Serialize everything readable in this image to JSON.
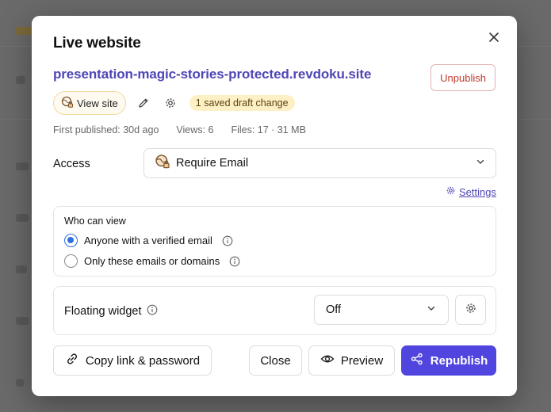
{
  "dialog": {
    "title": "Live website",
    "site_url": "presentation-magic-stories-protected.revdoku.site",
    "unpublish_label": "Unpublish",
    "view_site_label": "View site",
    "draft_badge": "1 saved draft change",
    "meta": {
      "first_published": "First published: 30d ago",
      "views": "Views: 6",
      "files": "Files: 17 · 31 MB"
    },
    "access": {
      "label": "Access",
      "selected": "Require Email"
    },
    "settings_link": "Settings",
    "who_can_view": {
      "title": "Who can view",
      "options": [
        {
          "label": "Anyone with a verified email",
          "selected": true
        },
        {
          "label": "Only these emails or domains",
          "selected": false
        }
      ]
    },
    "floating_widget": {
      "label": "Floating widget",
      "selected": "Off"
    },
    "buttons": {
      "copy_link": "Copy link & password",
      "close": "Close",
      "preview": "Preview",
      "republish": "Republish"
    }
  },
  "icons": {
    "close": "close-icon",
    "view_site": "lock-globe-icon",
    "edit": "pencil-icon",
    "settings": "gear-icon",
    "access": "lock-globe-icon",
    "chevron": "chevron-down-icon",
    "info": "info-icon",
    "link": "link-icon",
    "eye": "eye-icon",
    "share": "share-icon"
  },
  "colors": {
    "accent": "#5145e0",
    "link": "#4f46b5",
    "danger": "#c0392b",
    "badge_bg": "#fdf0c4",
    "radio": "#2f6fe0"
  }
}
